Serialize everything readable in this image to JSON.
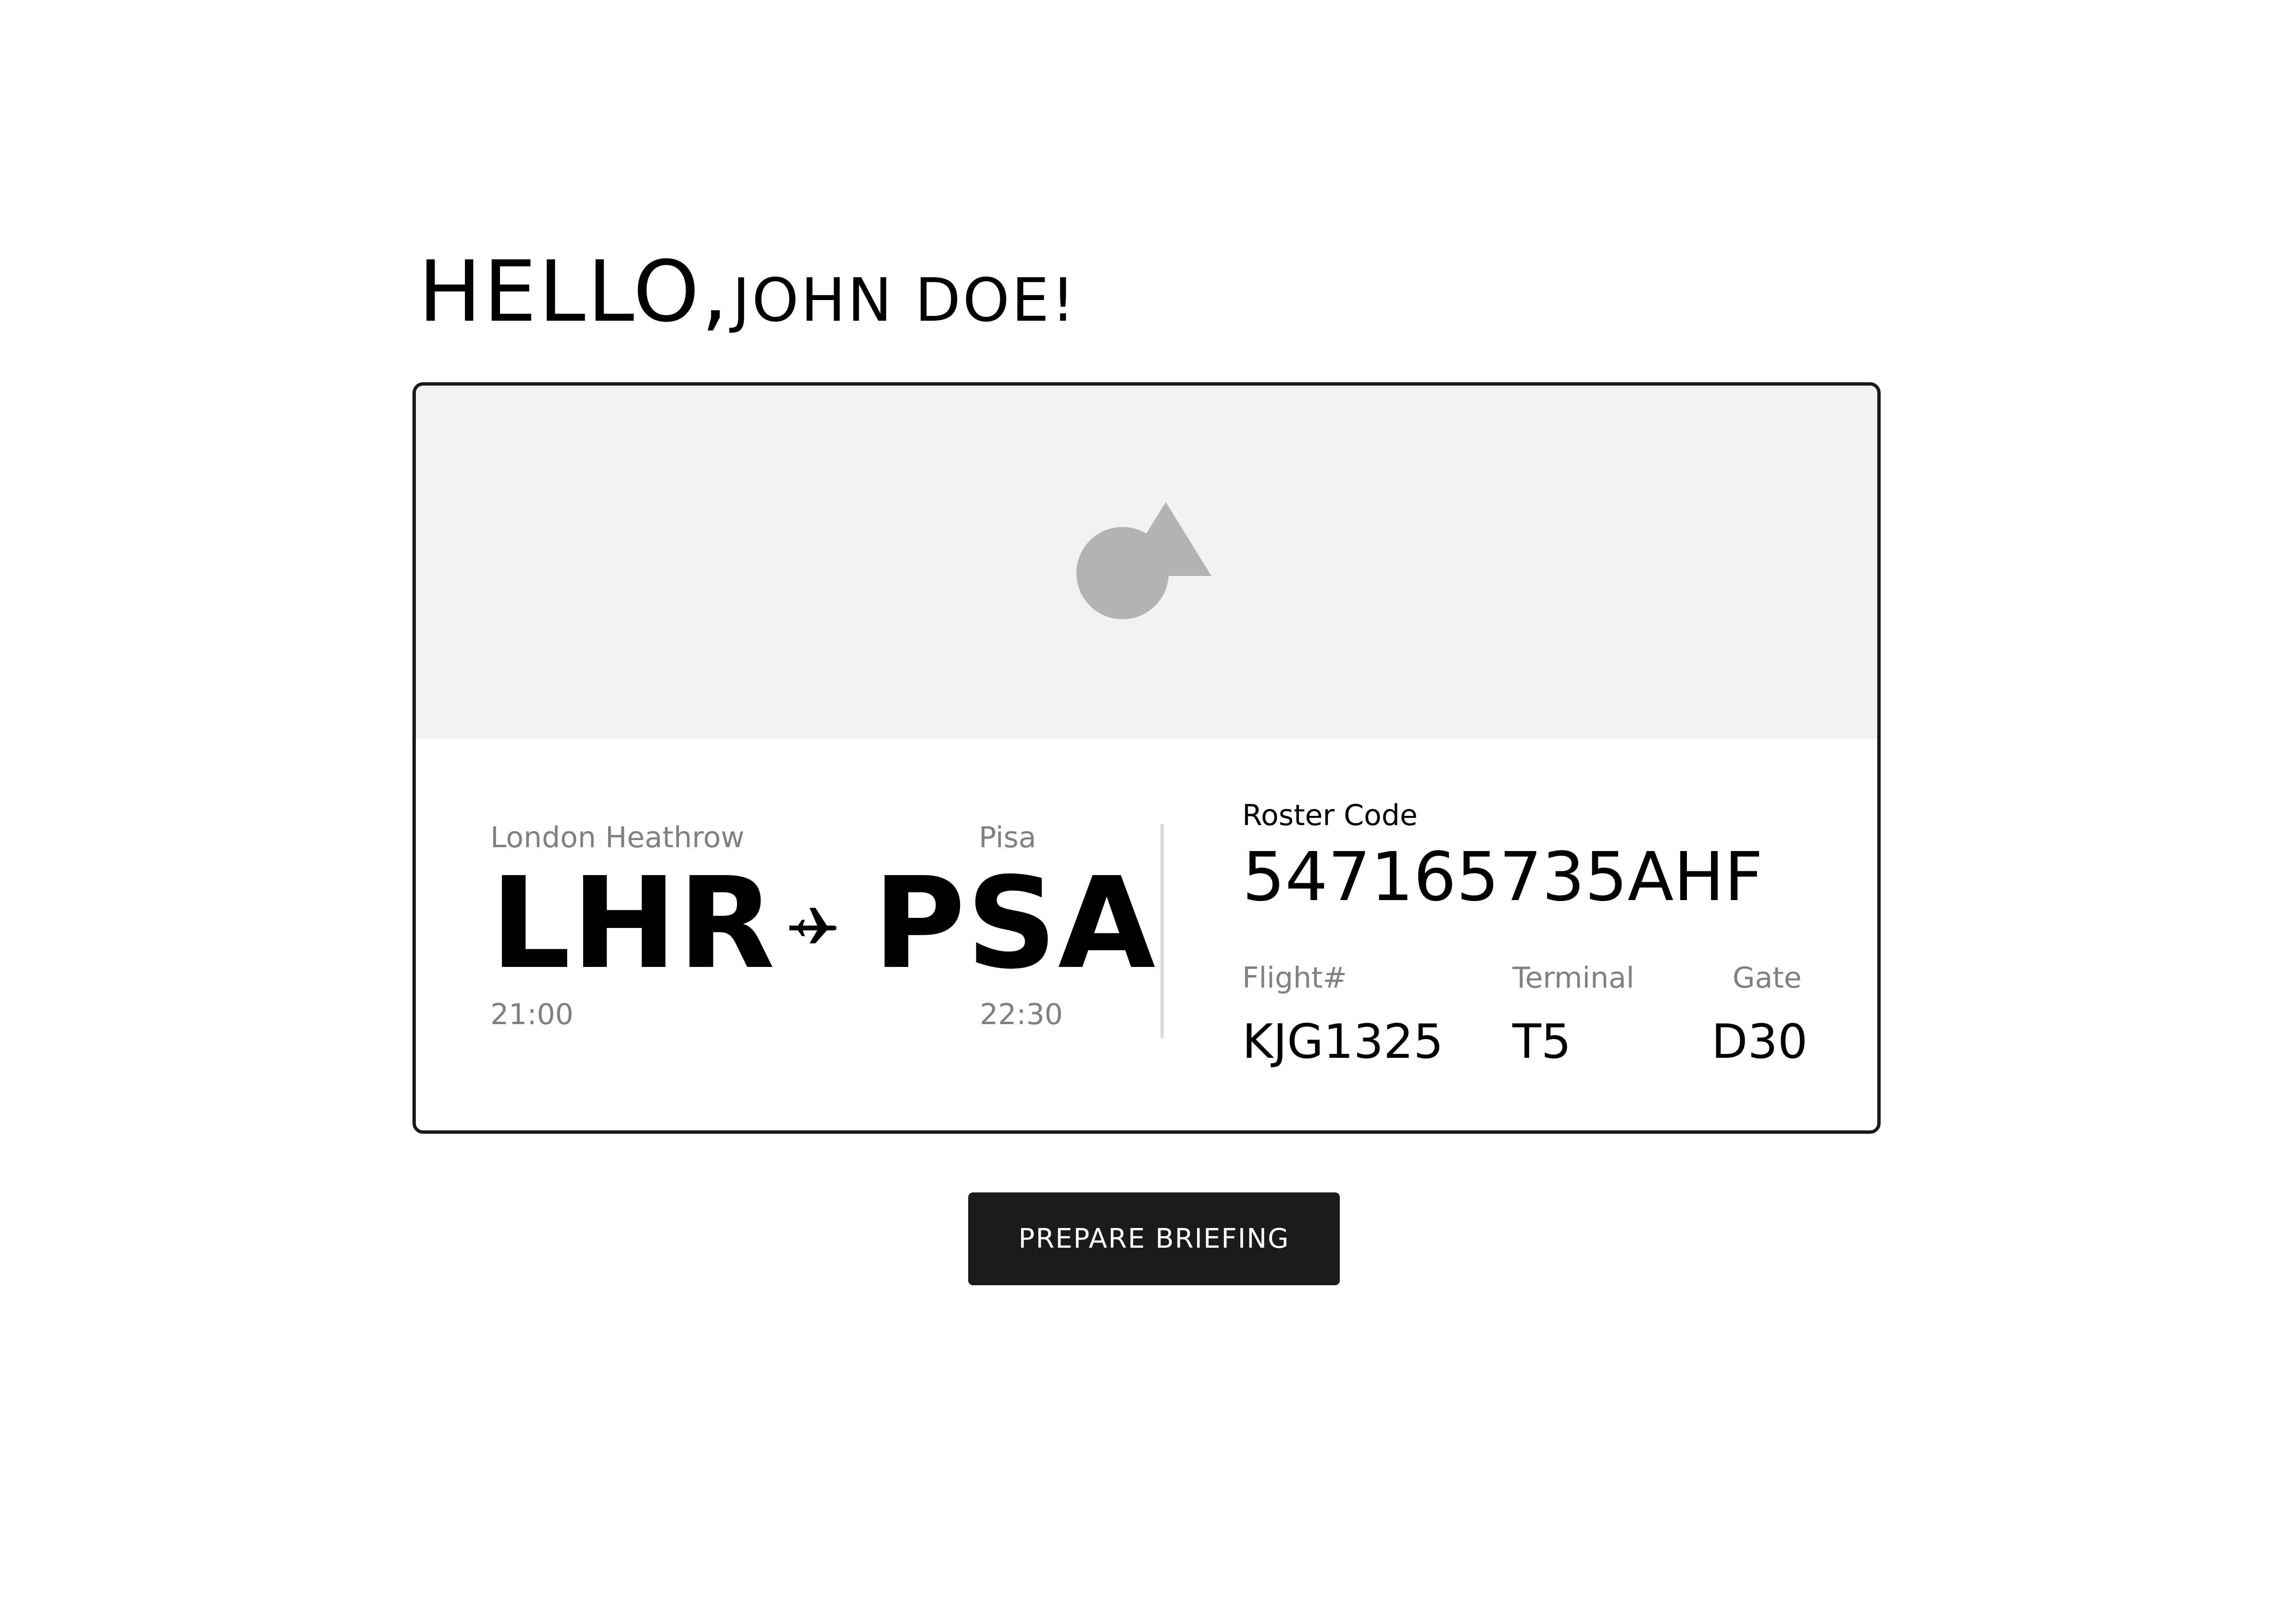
{
  "greeting": {
    "hello": "HELLO,",
    "name": "JOHN DOE!"
  },
  "card": {
    "image_placeholder_icon": "image-placeholder-icon",
    "origin": {
      "city": "London Heathrow",
      "code": "LHR",
      "time": "21:00"
    },
    "destination": {
      "city": "Pisa",
      "code": "PSA",
      "time": "22:30"
    },
    "route_icon": "plane-icon",
    "roster": {
      "label": "Roster Code",
      "code": "547165735AHF"
    },
    "details": [
      {
        "label": "Flight#",
        "value": "KJG1325"
      },
      {
        "label": "Terminal",
        "value": "T5"
      },
      {
        "label": "Gate",
        "value": "D30"
      }
    ]
  },
  "actions": {
    "prepare_label": "PREPARE BRIEFING"
  },
  "colors": {
    "text": "#000000",
    "muted": "#808080",
    "placeholder_bg": "#f2f2f2",
    "placeholder_icon": "#b3b3b3",
    "button_bg": "#1a1a1a",
    "button_text": "#ffffff"
  }
}
